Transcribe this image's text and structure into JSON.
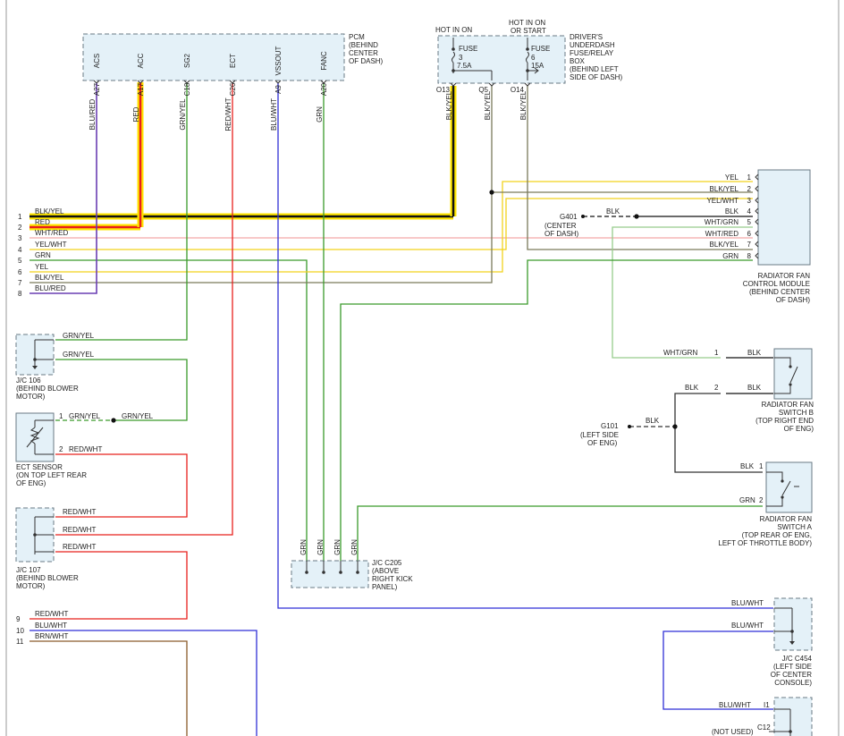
{
  "colors": {
    "blk": "#111111",
    "red": "#e8201c",
    "yel": "#f2d21c",
    "grn": "#3a9a2b",
    "ltgrn": "#96cc8c",
    "pink": "#f3a6a6",
    "blu": "#2f2fd6",
    "purple": "#6a3fb3",
    "gray": "#666666",
    "olive": "#7a7a5a",
    "brown": "#8a5a2a",
    "highlight": "#ffe600"
  },
  "pcm": {
    "label_lines": [
      "PCM",
      "(BEHIND",
      "CENTER",
      "OF DASH)"
    ],
    "pins": [
      {
        "name": "ACS",
        "num": "A27",
        "wire": "BLU/RED"
      },
      {
        "name": "ACC",
        "num": "A17",
        "wire": "RED"
      },
      {
        "name": "SG2",
        "num": "C18",
        "wire": "GRN/YEL"
      },
      {
        "name": "ECT",
        "num": "C26",
        "wire": "RED/WHT"
      },
      {
        "name": "VSSOUT",
        "num": "A9",
        "wire": "BLU/WHT"
      },
      {
        "name": "FANC",
        "num": "A20",
        "wire": "GRN"
      }
    ]
  },
  "fuse_box": {
    "label_lines": [
      "DRIVER'S",
      "UNDERDASH",
      "FUSE/RELAY",
      "BOX",
      "(BEHIND LEFT",
      "SIDE OF DASH)"
    ],
    "hot_left": "HOT IN ON",
    "hot_right_lines": [
      "HOT IN ON",
      "OR START"
    ],
    "fuse1": {
      "label": "FUSE",
      "num": "3",
      "amps": "7.5A"
    },
    "fuse2": {
      "label": "FUSE",
      "num": "6",
      "amps": "15A"
    },
    "pins": [
      {
        "num": "O13",
        "wire": "BLK/YEL"
      },
      {
        "num": "Q5",
        "wire": "BLK/YEL"
      },
      {
        "num": "O14",
        "wire": "BLK/YEL"
      }
    ]
  },
  "left_rows": [
    {
      "num": "1",
      "wire": "BLK/YEL"
    },
    {
      "num": "2",
      "wire": "RED"
    },
    {
      "num": "3",
      "wire": "WHT/RED"
    },
    {
      "num": "4",
      "wire": "YEL/WHT"
    },
    {
      "num": "5",
      "wire": "GRN"
    },
    {
      "num": "6",
      "wire": "YEL"
    },
    {
      "num": "7",
      "wire": "BLK/YEL"
    },
    {
      "num": "8",
      "wire": "BLU/RED"
    }
  ],
  "fan_module": {
    "label_lines": [
      "RADIATOR FAN",
      "CONTROL MODULE",
      "(BEHIND CENTER",
      "OF DASH)"
    ],
    "pins": [
      {
        "num": "1",
        "wire": "YEL"
      },
      {
        "num": "2",
        "wire": "BLK/YEL"
      },
      {
        "num": "3",
        "wire": "YEL/WHT"
      },
      {
        "num": "4",
        "wire": "BLK"
      },
      {
        "num": "5",
        "wire": "WHT/GRN"
      },
      {
        "num": "6",
        "wire": "WHT/RED"
      },
      {
        "num": "7",
        "wire": "BLK/YEL"
      },
      {
        "num": "8",
        "wire": "GRN"
      }
    ]
  },
  "g401": {
    "name": "G401",
    "wire": "BLK",
    "label_lines": [
      "(CENTER",
      "OF DASH)"
    ]
  },
  "g101": {
    "name": "G101",
    "wire": "BLK",
    "label_lines": [
      "(LEFT SIDE",
      "OF ENG)"
    ]
  },
  "jc106": {
    "label_lines": [
      "J/C 106",
      "(BEHIND BLOWER",
      "MOTOR)"
    ],
    "wire_top": "GRN/YEL",
    "wire_bottom": "GRN/YEL"
  },
  "ect": {
    "label_lines": [
      "ECT SENSOR",
      "(ON TOP LEFT REAR",
      "OF ENG)"
    ],
    "pin1": "1",
    "pin2": "2",
    "wire1": "GRN/YEL",
    "wire1b": "GRN/YEL",
    "wire2": "RED/WHT"
  },
  "jc107": {
    "label_lines": [
      "J/C 107",
      "(BEHIND BLOWER",
      "MOTOR)"
    ],
    "wire_top": "RED/WHT",
    "wire_mid": "RED/WHT",
    "wire_bottom": "RED/WHT"
  },
  "jcc205": {
    "label_lines": [
      "J/C C205",
      "(ABOVE",
      "RIGHT KICK",
      "PANEL)"
    ],
    "wires": [
      "GRN",
      "GRN",
      "GRN",
      "GRN",
      "GRN"
    ]
  },
  "switch_b": {
    "label_lines": [
      "RADIATOR FAN",
      "SWITCH B",
      "(TOP RIGHT END",
      "OF ENG)"
    ],
    "pin1": "1",
    "pin2": "2",
    "wire_in1": "WHT/GRN",
    "wire_out1": "BLK",
    "wire_in2": "BLK",
    "wire_out2": "BLK"
  },
  "switch_a": {
    "label_lines": [
      "RADIATOR FAN",
      "SWITCH A",
      "(TOP REAR OF ENG,",
      "LEFT OF THROTTLE BODY)"
    ],
    "pin1": "1",
    "pin2": "2",
    "wire1": "BLK",
    "wire2": "GRN"
  },
  "jcc454": {
    "label_lines": [
      "J/C C454",
      "(LEFT SIDE",
      "OF CENTER",
      "CONSOLE)"
    ],
    "wire_top": "BLU/WHT",
    "wire_bottom": "BLU/WHT"
  },
  "bottom_right": {
    "pin_i1": "I1",
    "pin_c12": "C12",
    "wire": "BLU/WHT",
    "not_used": "(NOT USED)"
  },
  "bottom_left": [
    {
      "num": "9",
      "wire": "RED/WHT"
    },
    {
      "num": "10",
      "wire": "BLU/WHT"
    },
    {
      "num": "11",
      "wire": "BRN/WHT"
    }
  ]
}
